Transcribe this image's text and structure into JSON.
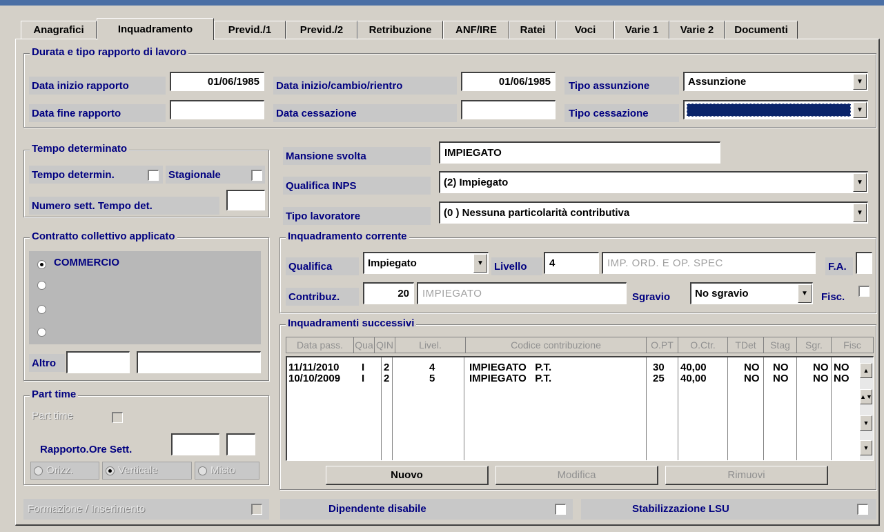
{
  "tabs": [
    "Anagrafici",
    "Inquadramento",
    "Previd./1",
    "Previd./2",
    "Retribuzione",
    "ANF/IRE",
    "Ratei",
    "Voci",
    "Varie 1",
    "Varie 2",
    "Documenti"
  ],
  "durata": {
    "title": "Durata e tipo rapporto di lavoro",
    "data_inizio_label": "Data inizio rapporto",
    "data_inizio_value": "01/06/1985",
    "data_fine_label": "Data fine rapporto",
    "data_fine_value": "",
    "data_cambio_label": "Data inizio/cambio/rientro",
    "data_cambio_value": "01/06/1985",
    "data_cessazione_label": "Data cessazione",
    "data_cessazione_value": "",
    "tipo_assunzione_label": "Tipo assunzione",
    "tipo_assunzione_value": "Assunzione",
    "tipo_cessazione_label": "Tipo cessazione",
    "tipo_cessazione_value": ""
  },
  "tempo": {
    "title": "Tempo determinato",
    "determin_label": "Tempo determin.",
    "stagionale_label": "Stagionale",
    "numero_label": "Numero sett. Tempo det.",
    "numero_value": ""
  },
  "mansione": {
    "mansione_label": "Mansione svolta",
    "mansione_value": "IMPIEGATO",
    "qualifica_label": "Qualifica INPS",
    "qualifica_value": "(2) Impiegato",
    "tipo_label": "Tipo lavoratore",
    "tipo_value": "(0 ) Nessuna particolarità contributiva"
  },
  "contratto": {
    "title": "Contratto collettivo applicato",
    "options": [
      "COMMERCIO",
      "",
      "",
      ""
    ],
    "altro_label": "Altro",
    "altro_value1": "",
    "altro_value2": ""
  },
  "corrente": {
    "title": "Inquadramento corrente",
    "qualifica_label": "Qualifica",
    "qualifica_value": "Impiegato",
    "livello_label": "Livello",
    "livello_value": "4",
    "livello_desc": "IMP. ORD. E OP. SPEC",
    "fa_label": "F.A.",
    "fa_value": "",
    "contribuz_label": "Contribuz.",
    "contribuz_value": "20",
    "contribuz_desc": "IMPIEGATO",
    "sgravio_label": "Sgravio",
    "sgravio_value": "No sgravio",
    "fisc_label": "Fisc."
  },
  "successivi": {
    "title": "Inquadramenti successivi",
    "columns": [
      "Data pass.",
      "Qua",
      "QIN",
      "Livel.",
      "Codice contribuzione",
      "O.PT",
      "O.Ctr.",
      "TDet",
      "Stag",
      "Sgr.",
      "Fisc"
    ],
    "rows": [
      [
        "11/11/2010",
        "I",
        "2",
        "4",
        "IMPIEGATO   P.T.",
        "30",
        "40,00",
        "NO",
        "NO",
        "NO",
        "NO"
      ],
      [
        "10/10/2009",
        "I",
        "2",
        "5",
        "IMPIEGATO   P.T.",
        "25",
        "40,00",
        "NO",
        "NO",
        "NO",
        "NO"
      ]
    ],
    "btn_nuovo": "Nuovo",
    "btn_modifica": "Modifica",
    "btn_rimuovi": "Rimuovi"
  },
  "parttime": {
    "title": "Part time",
    "check_label": "Part time",
    "rapporto_label": "Rapporto.Ore Sett.",
    "rapporto_value1": "",
    "rapporto_value2": "",
    "opt_orizz": "Orizz.",
    "opt_verticale": "Verticale",
    "opt_misto": "Misto"
  },
  "footer": {
    "formazione_label": "Formazione / Inserimento",
    "disabile_label": "Dipendente disabile",
    "lsu_label": "Stabilizzazione LSU"
  }
}
